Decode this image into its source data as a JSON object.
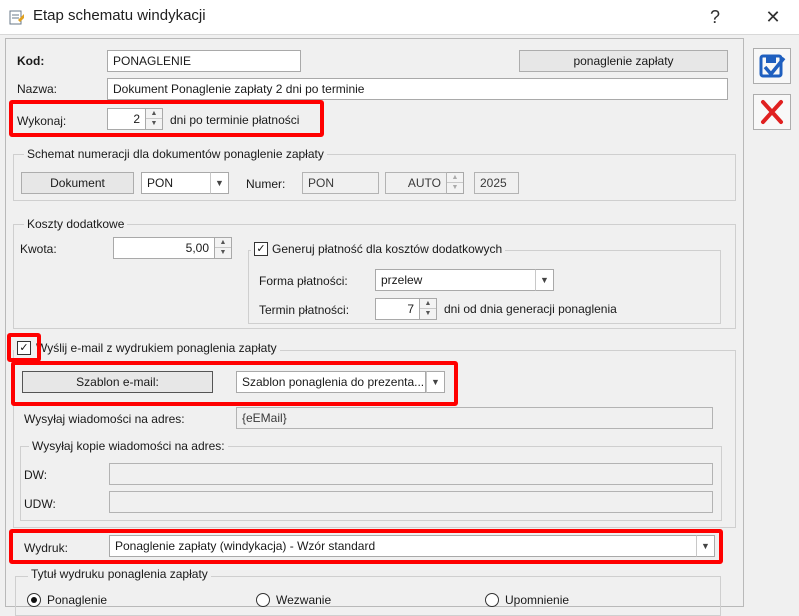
{
  "window": {
    "title": "Etap schematu windykacji",
    "help_glyph": "?",
    "close_glyph": "✕"
  },
  "header": {
    "kod_label": "Kod:",
    "kod_value": "PONAGLENIE",
    "doc_type_button": "ponaglenie zapłaty",
    "nazwa_label": "Nazwa:",
    "nazwa_value": "Dokument Ponaglenie zapłaty 2 dni po terminie",
    "wykonaj_label": "Wykonaj:",
    "wykonaj_value": "2",
    "wykonaj_suffix": "dni po terminie płatności"
  },
  "numbering": {
    "group_label": "Schemat numeracji dla dokumentów ponaglenie zapłaty",
    "document_button": "Dokument",
    "series_value": "PON",
    "numer_label": "Numer:",
    "numer_value": "PON",
    "auto_value": "AUTO",
    "year_value": "2025"
  },
  "costs": {
    "group_label": "Koszty dodatkowe",
    "kwota_label": "Kwota:",
    "kwota_value": "5,00",
    "generate_payment_label": "Generuj płatność dla kosztów dodatkowych",
    "generate_payment_checked": true,
    "forma_label": "Forma płatności:",
    "forma_value": "przelew",
    "termin_label": "Termin płatności:",
    "termin_value": "7",
    "termin_suffix": "dni od dnia generacji ponaglenia"
  },
  "email": {
    "send_label": "Wyślij e-mail z wydrukiem ponaglenia zapłaty",
    "send_checked": true,
    "template_button": "Szablon e-mail:",
    "template_value": "Szablon ponaglenia do prezenta...",
    "address_label": "Wysyłaj wiadomości na adres:",
    "address_value": "{eEMail}",
    "copies_group_label": "Wysyłaj kopie wiadomości na adres:",
    "dw_label": "DW:",
    "dw_value": "",
    "udw_label": "UDW:",
    "udw_value": ""
  },
  "print": {
    "wydruk_label": "Wydruk:",
    "wydruk_value": "Ponaglenie zapłaty (windykacja) - Wzór standard",
    "title_group_label": "Tytuł wydruku ponaglenia zapłaty",
    "options": [
      {
        "label": "Ponaglenie",
        "selected": true
      },
      {
        "label": "Wezwanie",
        "selected": false
      },
      {
        "label": "Upomnienie",
        "selected": false
      }
    ]
  },
  "colors": {
    "highlight": "#ff0000",
    "save_icon": "#1f5fbf",
    "cancel_icon": "#e02020"
  },
  "icons": {
    "save": "save-icon",
    "cancel": "cancel-icon",
    "app": "app-icon"
  }
}
